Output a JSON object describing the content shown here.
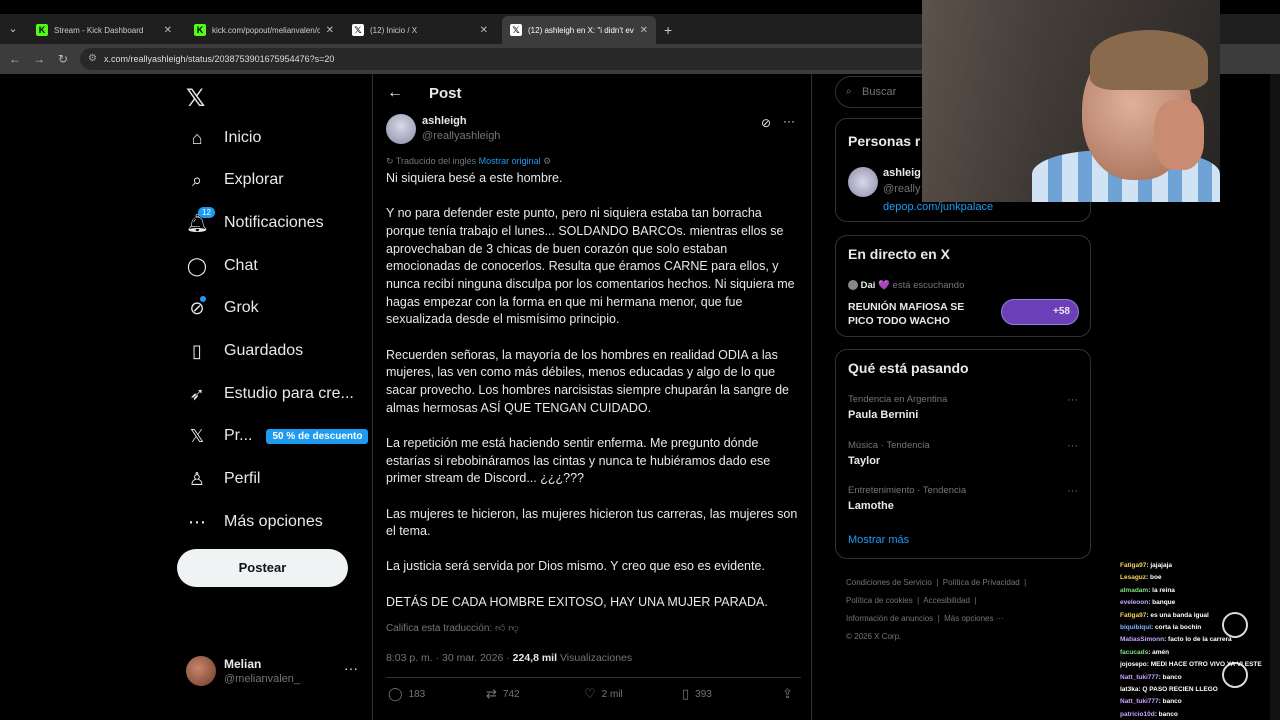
{
  "browser": {
    "tabs": [
      {
        "label": "Stream - Kick Dashboard",
        "favicon": "K",
        "active": false
      },
      {
        "label": "kick.com/popout/melianvalen/c",
        "favicon": "K",
        "active": false
      },
      {
        "label": "(12) Inicio / X",
        "favicon": "X",
        "active": false
      },
      {
        "label": "(12) ashleigh en X: \"i didn't eve",
        "favicon": "X",
        "active": true
      }
    ],
    "url": "x.com/reallyashleigh/status/2038753901675954476?s=20"
  },
  "nav": {
    "items": [
      {
        "label": "Inicio",
        "icon": "home-icon"
      },
      {
        "label": "Explorar",
        "icon": "search-icon"
      },
      {
        "label": "Notificaciones",
        "icon": "bell-icon",
        "badge": "12"
      },
      {
        "label": "Chat",
        "icon": "chat-icon"
      },
      {
        "label": "Grok",
        "icon": "grok-icon"
      },
      {
        "label": "Guardados",
        "icon": "bookmark-icon"
      },
      {
        "label": "Estudio para cre...",
        "icon": "rocket-icon"
      },
      {
        "label": "Pr...",
        "icon": "x-premium-icon",
        "promo": "50 % de descuento"
      },
      {
        "label": "Perfil",
        "icon": "person-icon"
      },
      {
        "label": "Más opciones",
        "icon": "more-circle-icon"
      }
    ],
    "post_button": "Postear",
    "me": {
      "name": "Melian",
      "handle": "@melianvalen_"
    }
  },
  "post": {
    "header": "Post",
    "author_name": "ashleigh",
    "author_handle": "@reallyashleigh",
    "translated_from": "Traducido del inglés",
    "show_original": "Mostrar original",
    "paragraphs": [
      "Ni siquiera besé a este hombre.",
      "Y no para defender este punto, pero ni siquiera estaba tan borracha porque tenía trabajo el lunes... SOLDANDO BARCOs. mientras ellos se aprovechaban de 3 chicas de buen corazón que solo estaban emocionadas de conocerlos. Resulta que éramos CARNE para ellos, y nunca recibí ninguna disculpa por los comentarios hechos. Ni siquiera me hagas empezar con la forma en que mi hermana menor, que fue sexualizada desde el mismísimo principio.",
      "Recuerden señoras, la mayoría de los hombres en realidad ODIA a las mujeres, las ven como más débiles, menos educadas y algo de lo que sacar provecho. Los hombres narcisistas siempre chuparán la sangre de almas hermosas ASÍ QUE TENGAN CUIDADO.",
      "La repetición me está haciendo sentir enferma. Me pregunto dónde estarías si rebobináramos las cintas y nunca te hubiéramos dado ese primer stream de Discord... ¿¿¿???",
      "Las mujeres te hicieron, las mujeres hicieron tus carreras, las mujeres son el tema.",
      "La justicia será servida por Dios mismo. Y creo que eso es evidente.",
      "DETÁS DE CADA HOMBRE EXITOSO, HAY UNA MUJER PARADA."
    ],
    "rate_translation": "Califica esta traducción:",
    "time": "8:03 p. m. · 30 mar. 2026 ·",
    "views": "224,8 mil",
    "views_label": "Visualizaciones",
    "replies": "183",
    "reposts": "742",
    "likes": "2 mil",
    "bookmarks": "393"
  },
  "right": {
    "search_placeholder": "Buscar",
    "people_title": "Personas r",
    "person_name": "ashleig",
    "person_handle": "@really",
    "person_link": "depop.com/junkpalace",
    "live_title": "En directo en X",
    "live_host": "Dai 💜",
    "live_status": "está escuchando",
    "live_space_title": "REUNIÓN MAFIOSA SE PICO TODO WACHO",
    "live_count": "+58",
    "trends_title": "Qué está pasando",
    "trends": [
      {
        "context": "Tendencia en Argentina",
        "name": "Paula Bernini"
      },
      {
        "context": "Música · Tendencia",
        "name": "Taylor"
      },
      {
        "context": "Entretenimiento · Tendencia",
        "name": "Lamothe"
      }
    ],
    "show_more": "Mostrar más",
    "footer": [
      "Condiciones de Servicio",
      "Política de Privacidad",
      "Política de cookies",
      "Accesibilidad",
      "Información de anuncios",
      "Más opciones ···",
      "© 2026 X Corp."
    ]
  },
  "chat": [
    {
      "user": "Fatiga97",
      "msg": ": jajajaja"
    },
    {
      "user": "Lesaguz",
      "msg": ": boe"
    },
    {
      "user": "almadam",
      "msg": ": la reina"
    },
    {
      "user": "eveleoon",
      "msg": ": banque"
    },
    {
      "user": "Fatiga97",
      "msg": ": es una banda igual"
    },
    {
      "user": "biquibiqui",
      "msg": ": corta la bochin"
    },
    {
      "user": "MatiasSimonn",
      "msg": ": facto lo de la carrera"
    },
    {
      "user": "facucads",
      "msg": ": amén"
    },
    {
      "user": "jojosepo",
      "msg": ": MEDI HACE OTRO VIVO YA VI ESTE"
    },
    {
      "user": "Natt_tuki777",
      "msg": ": banco"
    },
    {
      "user": "lat3ka",
      "msg": ": Q PASO RECIEN LLEGO"
    },
    {
      "user": "Natt_tuki777",
      "msg": ": banco"
    },
    {
      "user": "patricio10d",
      "msg": ": banco"
    }
  ],
  "colors": {
    "accent": "#1d9bf0",
    "background": "#000000",
    "kick": "#53fc18"
  }
}
